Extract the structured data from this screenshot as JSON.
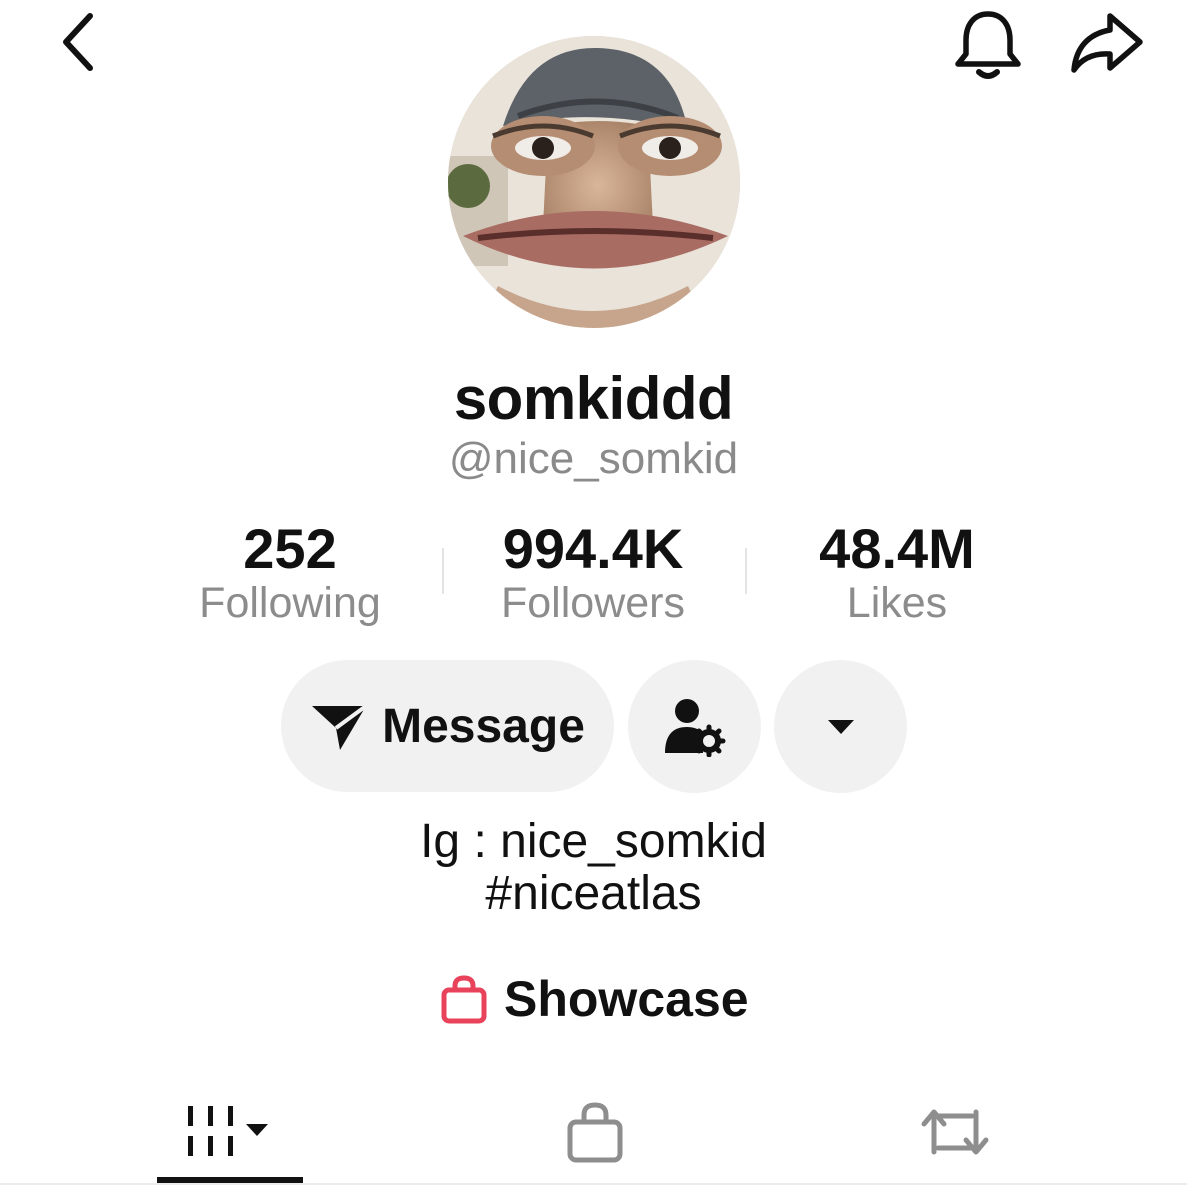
{
  "header": {
    "back_icon": "chevron-left-icon",
    "notification_icon": "bell-icon",
    "share_icon": "share-arrow-icon"
  },
  "profile": {
    "display_name": "somkiddd",
    "username": "@nice_somkid"
  },
  "stats": {
    "following": {
      "value": "252",
      "label": "Following"
    },
    "followers": {
      "value": "994.4K",
      "label": "Followers"
    },
    "likes": {
      "value": "48.4M",
      "label": "Likes"
    }
  },
  "actions": {
    "message_label": "Message",
    "message_icon": "paper-plane-icon",
    "friends_icon": "user-settings-icon",
    "more_icon": "caret-down-icon"
  },
  "bio": {
    "line1": "Ig : nice_somkid",
    "line2": "#niceatlas"
  },
  "showcase": {
    "label": "Showcase",
    "icon": "shopping-bag-icon",
    "icon_color": "#e8435a"
  },
  "tabs": [
    {
      "name": "videos",
      "icon": "video-grid-icon",
      "active": true
    },
    {
      "name": "shop",
      "icon": "shopping-bag-icon",
      "active": false
    },
    {
      "name": "reposts",
      "icon": "repost-icon",
      "active": false
    }
  ],
  "colors": {
    "text": "#111111",
    "secondary_text": "#8a8a8a",
    "button_bg": "#f1f1f1",
    "accent": "#e8435a"
  }
}
